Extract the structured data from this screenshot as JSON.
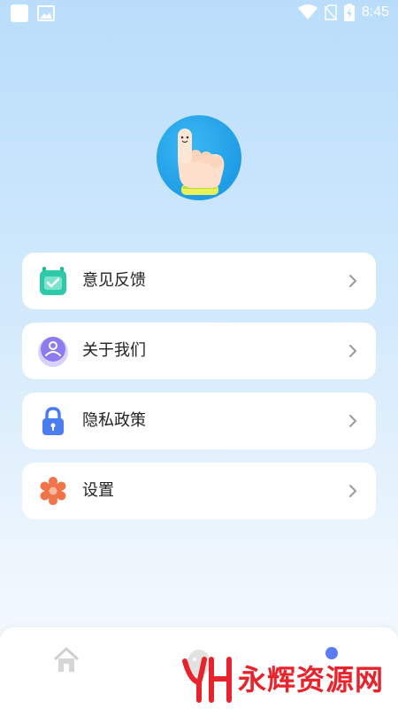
{
  "status_bar": {
    "time": "8:45"
  },
  "profile": {
    "avatar_icon": "pointing-finger-icon"
  },
  "menu": {
    "items": [
      {
        "label": "意见反馈",
        "icon": "calendar-check-icon",
        "color": "#2ec9a8"
      },
      {
        "label": "关于我们",
        "icon": "user-icon",
        "color": "#8b7cf0"
      },
      {
        "label": "隐私政策",
        "icon": "lock-icon",
        "color": "#4a7df0"
      },
      {
        "label": "设置",
        "icon": "gear-icon",
        "color": "#f0734a"
      }
    ]
  },
  "tabbar": {
    "tabs": [
      {
        "icon": "home-icon"
      },
      {
        "icon": "mascot-icon"
      },
      {
        "icon": "profile-icon"
      }
    ],
    "accent": "#5b7cf2"
  },
  "watermark": {
    "logo_text": "YH",
    "text": "永辉资源网"
  }
}
